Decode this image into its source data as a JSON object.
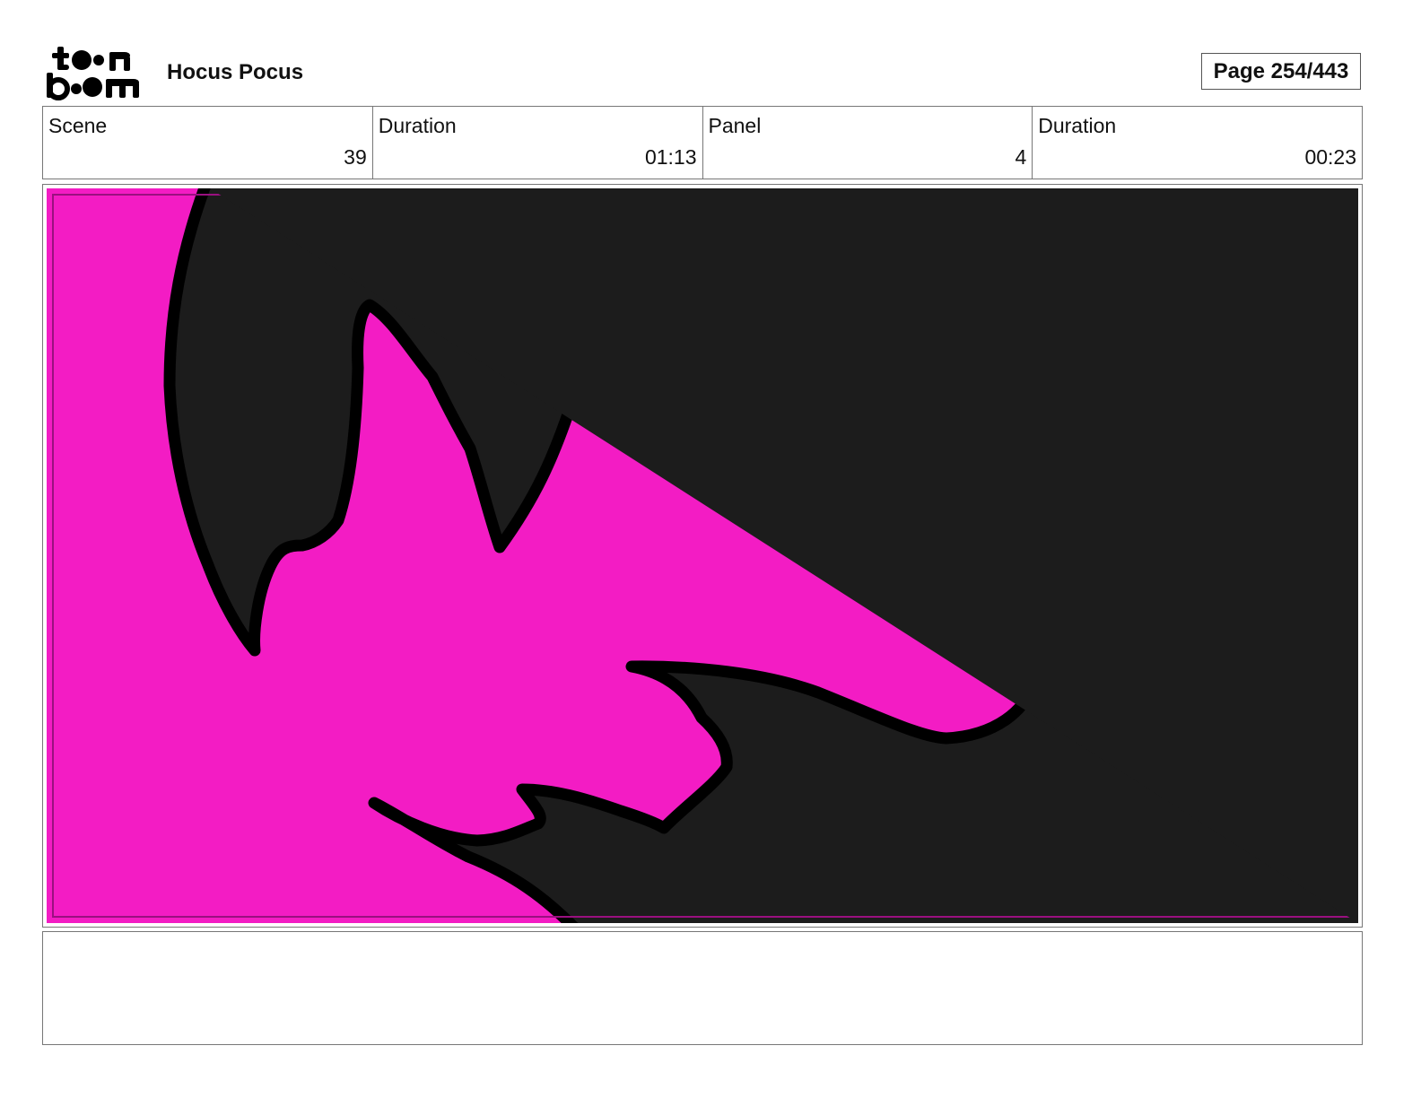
{
  "header": {
    "logo_icon": "toon-boom-logo-icon",
    "project_title": "Hocus Pocus",
    "page_label": "Page 254/443"
  },
  "info": {
    "scene": {
      "label": "Scene",
      "value": "39"
    },
    "scene_duration": {
      "label": "Duration",
      "value": "01:13"
    },
    "panel": {
      "label": "Panel",
      "value": "4"
    },
    "panel_duration": {
      "label": "Duration",
      "value": "00:23"
    }
  },
  "artwork": {
    "background_color": "#1c1c1c",
    "shape_color": "#f31cc4",
    "outline_color": "#000000"
  },
  "notes": {
    "text": ""
  }
}
